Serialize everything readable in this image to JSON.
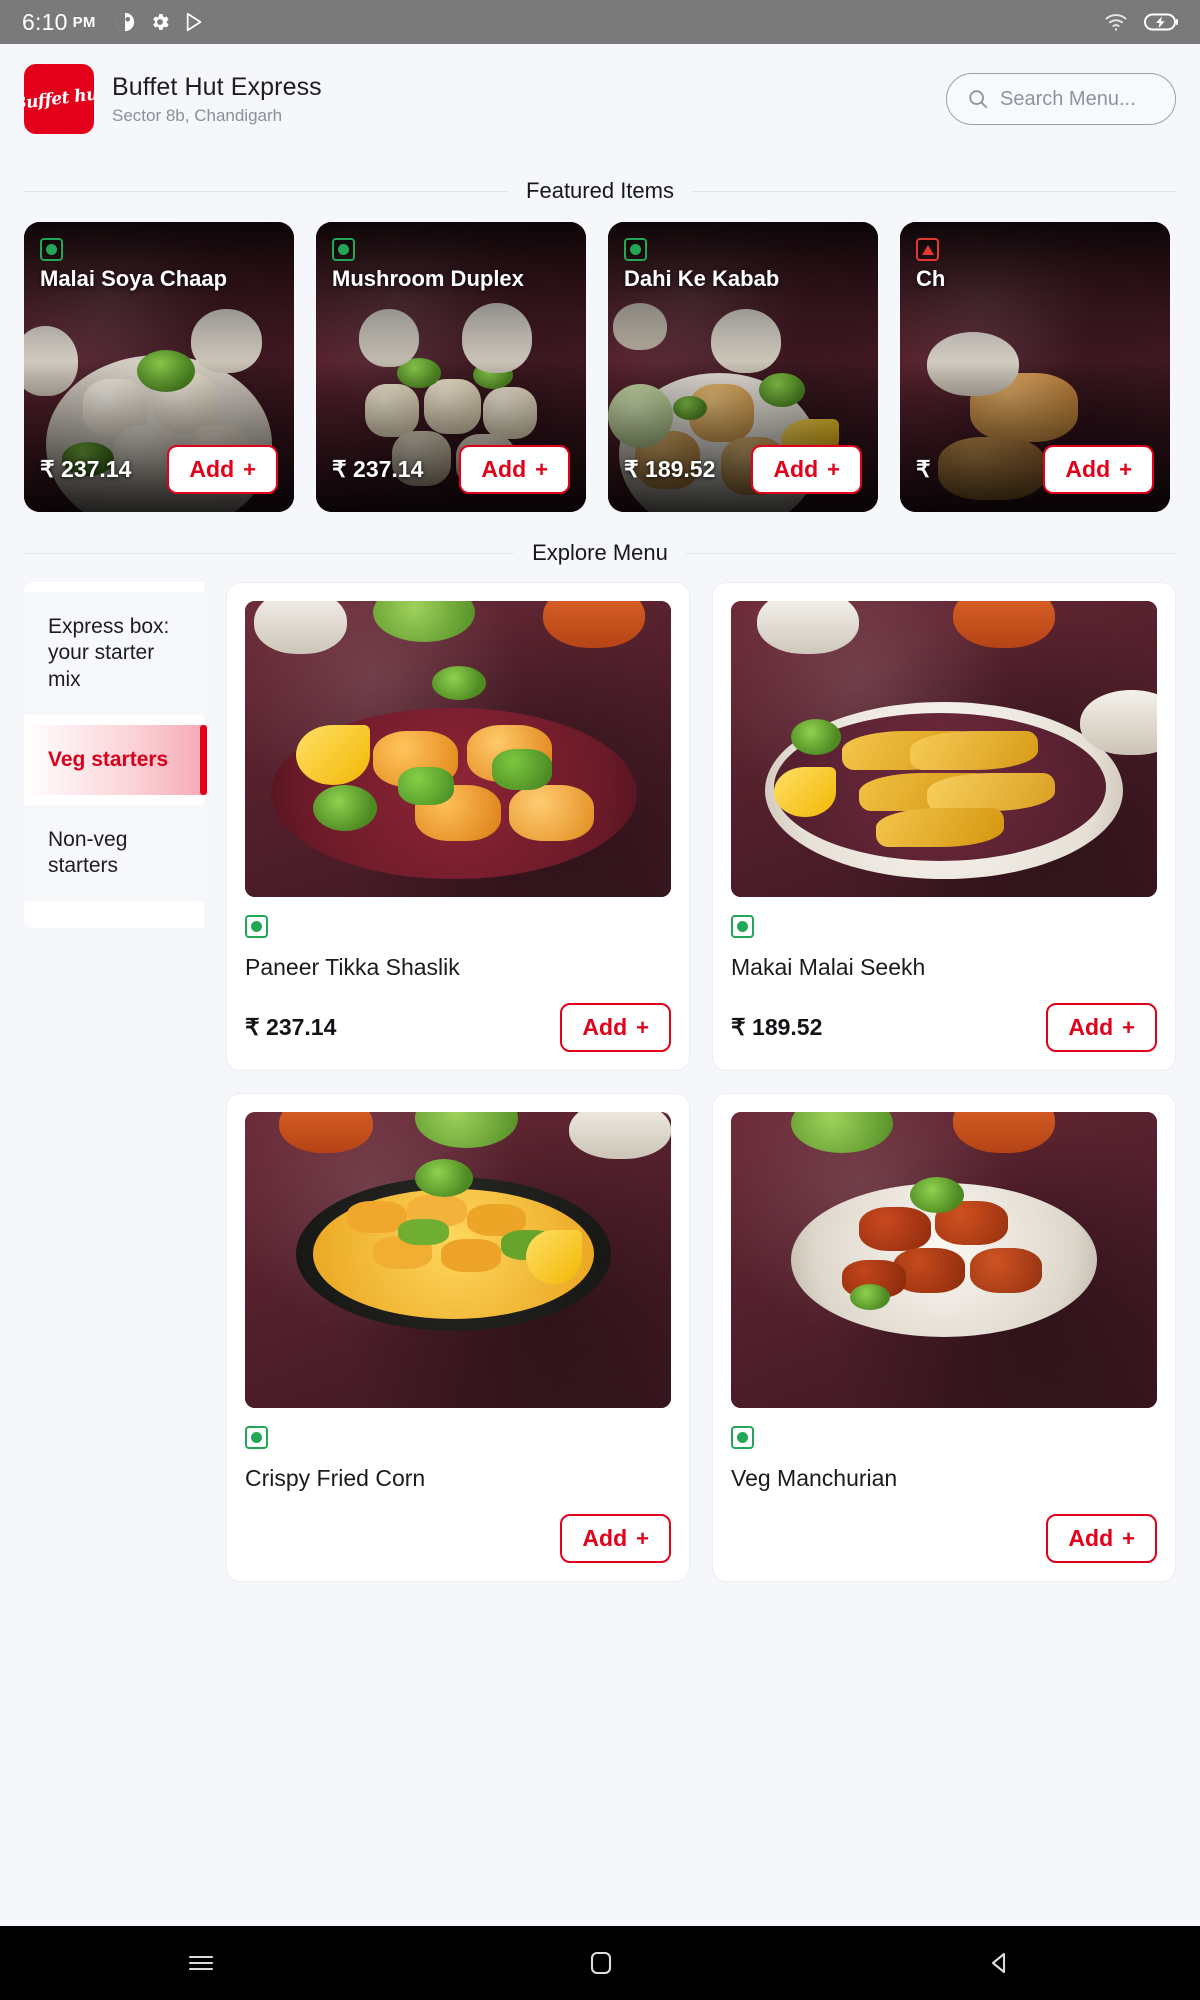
{
  "statusbar": {
    "time": "6:10",
    "ampm": "PM",
    "icons_left": [
      "contrast-icon",
      "gear-icon",
      "play-store-icon"
    ],
    "icons_right": [
      "wifi-icon",
      "battery-charging-icon"
    ]
  },
  "header": {
    "logo_text": "Buffet hut",
    "restaurant_name": "Buffet Hut Express",
    "location": "Sector 8b, Chandigarh",
    "search_placeholder": "Search Menu...",
    "search_value": ""
  },
  "featured": {
    "title": "Featured Items",
    "items": [
      {
        "name": "Malai Soya Chaap",
        "price": "₹ 237.14",
        "diet": "veg",
        "add_label": "Add",
        "add_plus": "+"
      },
      {
        "name": "Mushroom Duplex",
        "price": "₹ 237.14",
        "diet": "veg",
        "add_label": "Add",
        "add_plus": "+"
      },
      {
        "name": "Dahi Ke Kabab",
        "price": "₹ 189.52",
        "diet": "veg",
        "add_label": "Add",
        "add_plus": "+"
      },
      {
        "name": "Ch",
        "price": "₹",
        "diet": "nonveg",
        "add_label": "Add",
        "add_plus": "+"
      }
    ]
  },
  "explore": {
    "title": "Explore Menu",
    "categories": [
      {
        "label": "Express box: your starter mix",
        "active": false
      },
      {
        "label": "Veg starters",
        "active": true
      },
      {
        "label": "Non-veg starters",
        "active": false
      }
    ],
    "products": [
      {
        "name": "Paneer Tikka Shaslik",
        "price": "₹ 237.14",
        "diet": "veg",
        "add_label": "Add",
        "add_plus": "+"
      },
      {
        "name": "Makai Malai Seekh",
        "price": "₹ 189.52",
        "diet": "veg",
        "add_label": "Add",
        "add_plus": "+"
      },
      {
        "name": "Crispy Fried Corn",
        "price": "",
        "diet": "veg",
        "add_label": "Add",
        "add_plus": "+"
      },
      {
        "name": "Veg Manchurian",
        "price": "",
        "diet": "veg",
        "add_label": "Add",
        "add_plus": "+"
      }
    ]
  },
  "navbar": {
    "items": [
      "recents-icon",
      "home-icon",
      "back-icon"
    ]
  },
  "colors": {
    "brand_red": "#e2001a",
    "veg_green": "#23a757",
    "nonveg_red": "#e23b2e",
    "page_bg": "#f6f7fb"
  }
}
